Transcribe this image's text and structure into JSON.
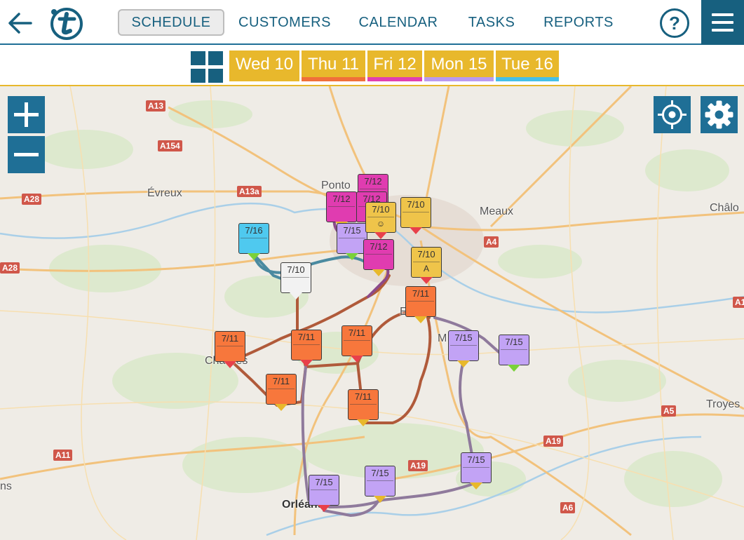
{
  "nav": {
    "tabs": [
      {
        "label": "SCHEDULE",
        "active": true
      },
      {
        "label": "CUSTOMERS",
        "active": false
      },
      {
        "label": "CALENDAR",
        "active": false
      },
      {
        "label": "TASKS",
        "active": false
      },
      {
        "label": "REPORTS",
        "active": false
      }
    ],
    "help_label": "?"
  },
  "days": [
    {
      "label": "Wed 10",
      "color": "#e8b82c"
    },
    {
      "label": "Thu 11",
      "color": "#f0703a"
    },
    {
      "label": "Fri 12",
      "color": "#e040b0"
    },
    {
      "label": "Mon 15",
      "color": "#b99af0"
    },
    {
      "label": "Tue 16",
      "color": "#45bfe8"
    }
  ],
  "colors": {
    "brand": "#17607f",
    "wed": "#efc44a",
    "thu": "#f7773c",
    "fri": "#e03cb0",
    "mon": "#c2a3f5",
    "tue": "#4fc9ef",
    "done": "#f2f2f2"
  },
  "map": {
    "road_labels": [
      "A13",
      "A154",
      "A28",
      "A13a",
      "A28",
      "A4",
      "A1",
      "A11",
      "A19",
      "A19",
      "A5",
      "A6"
    ],
    "cities": [
      "Évreux",
      "Ponto",
      "Meaux",
      "Châlo",
      "Ev",
      "M",
      "Chartres",
      "Troyes",
      "Orléans",
      "ns"
    ],
    "pins": [
      {
        "label": "7/16",
        "sub": "",
        "color": "#4fc9ef",
        "tip": "#7ad13a"
      },
      {
        "label": "7/10",
        "sub": "",
        "color": "#f2f2f2",
        "tip": "#f2f2f2"
      },
      {
        "label": "7/12",
        "sub": "",
        "color": "#e03cb0",
        "tip": "#e8b82c"
      },
      {
        "label": "7/12",
        "sub": "",
        "color": "#e03cb0",
        "tip": "#e03cb0"
      },
      {
        "label": "7/12",
        "sub": "",
        "color": "#e03cb0",
        "tip": "#e03cb0"
      },
      {
        "label": "7/15",
        "sub": "",
        "color": "#c2a3f5",
        "tip": "#7ad13a"
      },
      {
        "label": "7/10",
        "sub": "☺",
        "color": "#efc44a",
        "tip": "#e8404a"
      },
      {
        "label": "7/10",
        "sub": "",
        "color": "#efc44a",
        "tip": "#e8404a"
      },
      {
        "label": "7/12",
        "sub": "",
        "color": "#e03cb0",
        "tip": "#e8b82c"
      },
      {
        "label": "7/10",
        "sub": "A",
        "color": "#efc44a",
        "tip": "#e8404a"
      },
      {
        "label": "7/11",
        "sub": "",
        "color": "#f7773c",
        "tip": "#e8b82c"
      },
      {
        "label": "7/11",
        "sub": "",
        "color": "#f7773c",
        "tip": "#e8404a"
      },
      {
        "label": "7/11",
        "sub": "",
        "color": "#f7773c",
        "tip": "#e8404a"
      },
      {
        "label": "7/11",
        "sub": "",
        "color": "#f7773c",
        "tip": "#e8b82c"
      },
      {
        "label": "7/11",
        "sub": "",
        "color": "#f7773c",
        "tip": "#e8404a"
      },
      {
        "label": "7/11",
        "sub": "",
        "color": "#f7773c",
        "tip": "#e8b82c"
      },
      {
        "label": "7/15",
        "sub": "",
        "color": "#c2a3f5",
        "tip": "#e8b82c"
      },
      {
        "label": "7/15",
        "sub": "",
        "color": "#c2a3f5",
        "tip": "#7ad13a"
      },
      {
        "label": "7/15",
        "sub": "",
        "color": "#c2a3f5",
        "tip": "#e8404a"
      },
      {
        "label": "7/15",
        "sub": "",
        "color": "#c2a3f5",
        "tip": "#e8b82c"
      },
      {
        "label": "7/15",
        "sub": "",
        "color": "#c2a3f5",
        "tip": "#e8b82c"
      }
    ]
  }
}
